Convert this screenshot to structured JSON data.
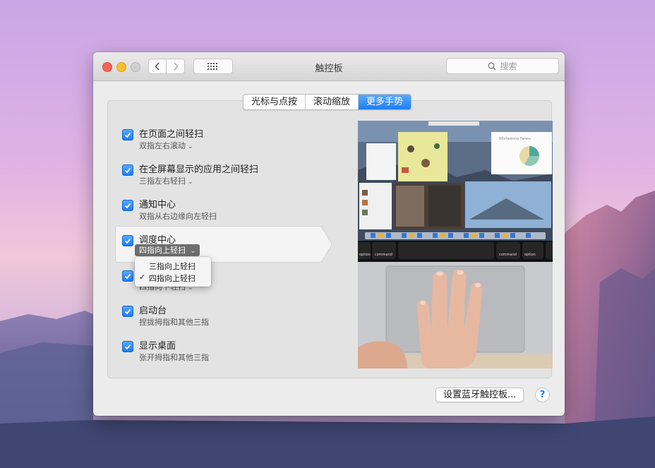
{
  "window": {
    "title": "触控板",
    "search_placeholder": "搜索"
  },
  "tabs": [
    {
      "label": "光标与点按",
      "active": false
    },
    {
      "label": "滚动缩放",
      "active": false
    },
    {
      "label": "更多手势",
      "active": true
    }
  ],
  "gestures": [
    {
      "title": "在页面之间轻扫",
      "sub": "双指左右滚动",
      "checked": true,
      "has_menu": true
    },
    {
      "title": "在全屏幕显示的应用之间轻扫",
      "sub": "三指左右轻扫",
      "checked": true,
      "has_menu": true
    },
    {
      "title": "通知中心",
      "sub": "双指从右边缘向左轻扫",
      "checked": true,
      "has_menu": false
    },
    {
      "title": "调度中心",
      "sub": "四指向上轻扫",
      "checked": true,
      "has_menu": true
    },
    {
      "title": "",
      "sub": "四指向下轻扫",
      "checked": true,
      "has_menu": true
    },
    {
      "title": "启动台",
      "sub": "捏拢拇指和其他三指",
      "checked": true,
      "has_menu": false
    },
    {
      "title": "显示桌面",
      "sub": "张开拇指和其他三指",
      "checked": true,
      "has_menu": false
    }
  ],
  "dropdown": {
    "selected": "四指向上轻扫",
    "options": [
      {
        "label": "三指向上轻扫",
        "checked": false
      },
      {
        "label": "四指向上轻扫",
        "checked": true
      }
    ]
  },
  "preview": {
    "keys": [
      "command",
      "command",
      "option",
      "option"
    ],
    "card_title": "Whitestone Farms"
  },
  "buttons": {
    "bluetooth": "设置蓝牙触控板...",
    "help": "?"
  },
  "colors": {
    "accent": "#1d7ef5",
    "close": "#fc5f57",
    "minimize": "#fdbc2e"
  }
}
